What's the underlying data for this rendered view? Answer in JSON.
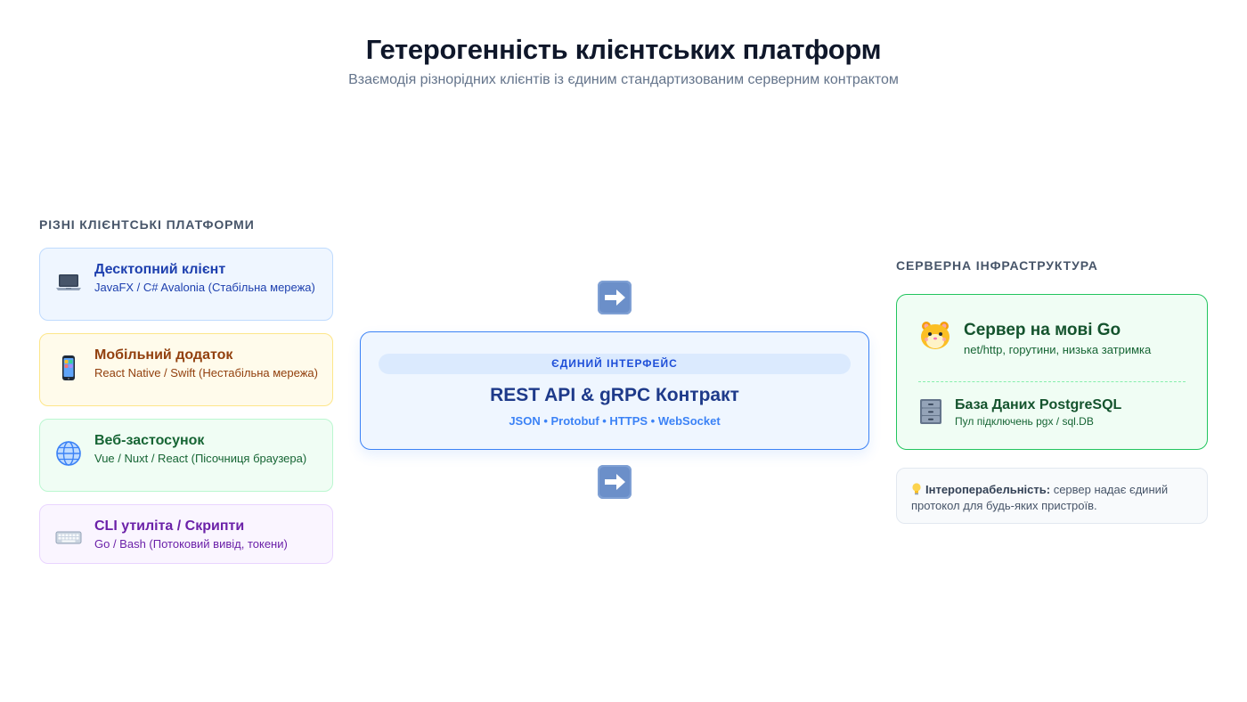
{
  "header": {
    "title": "Гетерогенність клієнтських платформ",
    "subtitle": "Взаємодія різнорідних клієнтів із єдиним стандартизованим серверним контрактом"
  },
  "clients": {
    "label": "РІЗНІ КЛІЄНТСЬКІ ПЛАТФОРМИ",
    "items": [
      {
        "name": "Десктопний клієнт",
        "desc": "JavaFX / C# Avalonia (Стабільна мережа)",
        "icon": "laptop-icon"
      },
      {
        "name": "Мобільний додаток",
        "desc": "React Native / Swift (Нестабільна мережа)",
        "icon": "mobile-phone-icon"
      },
      {
        "name": "Веб-застосунок",
        "desc": "Vue / Nuxt / React (Пісочниця браузера)",
        "icon": "globe-icon"
      },
      {
        "name": "CLI утиліта / Скрипти",
        "desc": "Go / Bash (Потоковий вивід, токени)",
        "icon": "keyboard-icon"
      }
    ]
  },
  "interface": {
    "tag": "ЄДИНИЙ ІНТЕРФЕЙС",
    "title": "REST API & gRPC Контракт",
    "protocols": "JSON • Protobuf • HTTPS • WebSocket"
  },
  "server": {
    "label": "СЕРВЕРНА ІНФРАСТРУКТУРА",
    "go": {
      "name": "Сервер на мові Go",
      "desc": "net/http, горутини, низька затримка",
      "icon": "hamster-icon"
    },
    "db": {
      "name": "База Даних PostgreSQL",
      "desc": "Пул підключень pgx / sql.DB",
      "icon": "file-cabinet-icon"
    }
  },
  "note": {
    "icon": "light-bulb-icon",
    "bold": "Інтероперабельність:",
    "text": " сервер надає єдиний протокол для будь-яких пристроїв."
  },
  "colors": {
    "accent_blue": "#3b82f6",
    "server_green": "#22c55e",
    "arrow": "#6b8fc9"
  }
}
